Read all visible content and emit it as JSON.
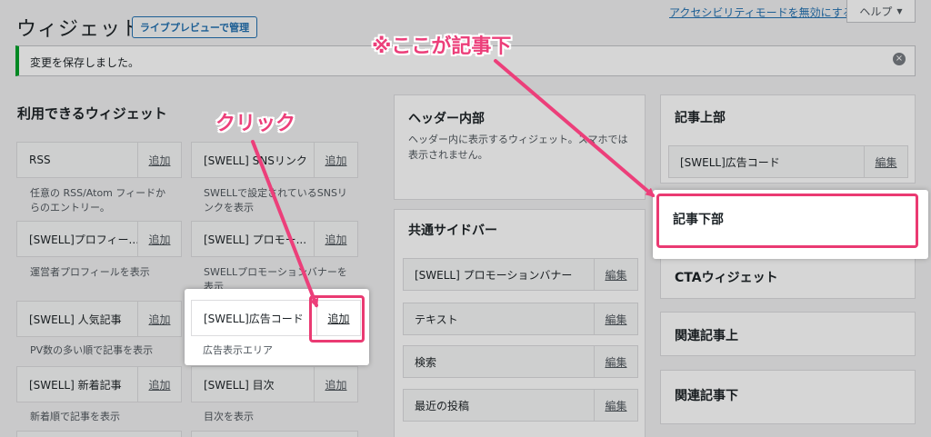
{
  "header": {
    "title": "ウィジェット",
    "preview_button": "ライブプレビューで管理",
    "accessibility_link": "アクセシビリティモードを無効にする",
    "help_label": "ヘルプ"
  },
  "notice": {
    "message": "変更を保存しました。",
    "close_icon": "×"
  },
  "available": {
    "title": "利用できるウィジェット",
    "add_label": "追加",
    "widgets": [
      {
        "name": "RSS",
        "desc": "任意の RSS/Atom フィードからのエントリー。"
      },
      {
        "name": "[SWELL] SNSリンク",
        "desc": "SWELLで設定されているSNSリンクを表示"
      },
      {
        "name": "[SWELL]プロフィー...",
        "desc": "運営者プロフィールを表示"
      },
      {
        "name": "[SWELL] プロモー...",
        "desc": "SWELLプロモーションバナーを表示"
      },
      {
        "name": "[SWELL] 人気記事",
        "desc": "PV数の多い順で記事を表示"
      },
      {
        "name": "[SWELL]広告コード",
        "desc": "広告表示エリア"
      },
      {
        "name": "[SWELL] 新着記事",
        "desc": "新着順で記事を表示"
      },
      {
        "name": "[SWELL] 目次",
        "desc": "目次を表示"
      }
    ]
  },
  "sidebars": {
    "edit_label": "編集",
    "header_inner": {
      "title": "ヘッダー内部",
      "desc": "ヘッダー内に表示するウィジェット。スマホでは表示されません。"
    },
    "common_sidebar": {
      "title": "共通サイドバー",
      "items": [
        "[SWELL] プロモーションバナー",
        "テキスト",
        "検索",
        "最近の投稿"
      ]
    },
    "article_top": {
      "title": "記事上部",
      "items": [
        "[SWELL]広告コード"
      ]
    },
    "article_bottom": {
      "title": "記事下部"
    },
    "cta": {
      "title": "CTAウィジェット"
    },
    "related_top": {
      "title": "関連記事上"
    },
    "related_bottom": {
      "title": "関連記事下"
    }
  },
  "annotations": {
    "click": "クリック",
    "here": "※ここが記事下"
  },
  "colors": {
    "highlight": "#ea3a72",
    "notice_accent": "#00a32a",
    "link": "#2271b1"
  }
}
